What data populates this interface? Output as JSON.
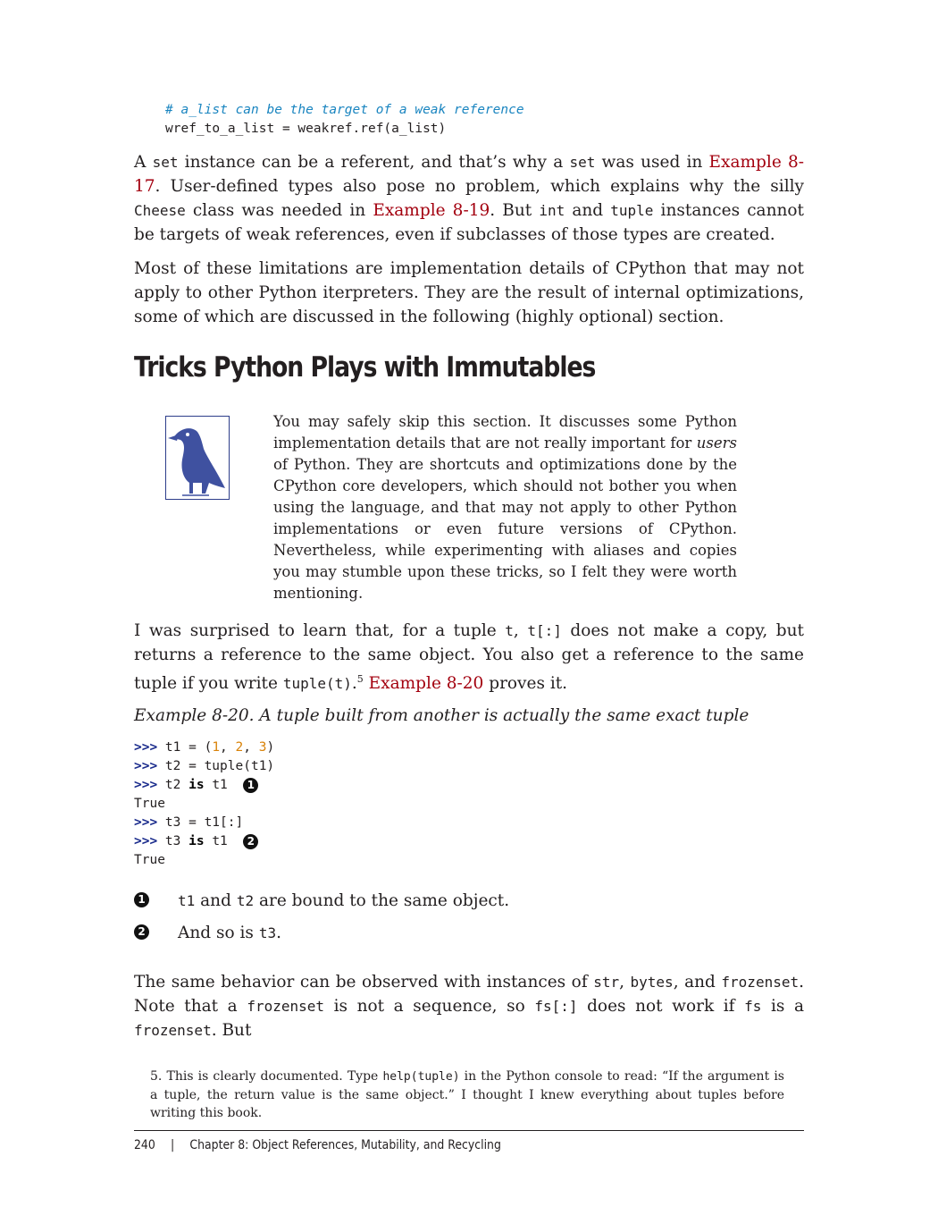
{
  "top_code": {
    "line1_comment": "# a_list can be the target of a weak reference",
    "line2": "wref_to_a_list = weakref.ref(a_list)"
  },
  "para1": {
    "t1": "A ",
    "c1": "set",
    "t2": " instance can be a referent, and that’s why a ",
    "c2": "set",
    "t3": " was used in ",
    "link1": "Example 8-17",
    "t4": ". User-defined types also pose no problem, which explains why the silly ",
    "c3": "Cheese",
    "t5": " class was needed in ",
    "link2": "Example 8-19",
    "t6": ". But ",
    "c4": "int",
    "t7": " and ",
    "c5": "tuple",
    "t8": " instances cannot be targets of weak references, even if subclasses of those types are created."
  },
  "para2": "Most of these limitations are implementation details of CPython that may not apply to other Python iterpreters. They are the result of internal optimizations, some of which are discussed in the following (highly optional) section.",
  "section_title": "Tricks Python Plays with Immutables",
  "note": {
    "icon": "crow-icon",
    "t1": "You may safely skip this section. It discusses some Python implementation details that are not really important for ",
    "em": "users",
    "t2": " of Python. They are shortcuts and optimizations done by the CPython core developers, which should not bother you when using the language, and that may not apply to other Python implementations or even future versions of CPython. Nevertheless, while experimenting with aliases and copies you may stumble upon these tricks, so I felt they were worth mentioning."
  },
  "para3": {
    "t1": "I was surprised to learn that, for a tuple ",
    "c1": "t",
    "t2": ", ",
    "c2": "t[:]",
    "t3": " does not make a copy, but returns a reference to the same object. You also get a reference to the same tuple if you write ",
    "c3": "tuple(t)",
    "t4": ".",
    "sup": "5",
    "t5": " ",
    "link": "Example 8-20",
    "t6": " proves it."
  },
  "example_caption": "Example 8-20. A tuple built from another is actually the same exact tuple",
  "example_code": {
    "prompt": ">>>",
    "l1_a": " t1 = (",
    "l1_n1": "1",
    "l1_b": ", ",
    "l1_n2": "2",
    "l1_c": ", ",
    "l1_n3": "3",
    "l1_d": ")",
    "l2": " t2 = tuple(t1)",
    "l3_a": " t2 ",
    "l3_kw": "is",
    "l3_b": " t1",
    "callout1": "1",
    "out1": "True",
    "l4": " t3 = t1[:]",
    "l5_a": " t3 ",
    "l5_kw": "is",
    "l5_b": " t1",
    "callout2": "2",
    "out2": "True"
  },
  "callouts": [
    {
      "marker": "1",
      "c1": "t1",
      "t1": " and ",
      "c2": "t2",
      "t2": " are bound to the same object."
    },
    {
      "marker": "2",
      "t1": "And so is ",
      "c1": "t3",
      "t2": "."
    }
  ],
  "para4": {
    "t1": "The same behavior can be observed with instances of ",
    "c1": "str",
    "t2": ", ",
    "c2": "bytes",
    "t3": ", and ",
    "c3": "frozenset",
    "t4": ". Note that a ",
    "c4": "frozenset",
    "t5": " is not a sequence, so ",
    "c5": "fs[:]",
    "t6": " does not work if ",
    "c6": "fs",
    "t7": " is a ",
    "c7": "frozenset",
    "t8": ". But"
  },
  "footnote": {
    "num": "5.",
    "t1": " This is clearly documented. Type ",
    "c1": "help(tuple)",
    "t2": " in the Python console to read: “If the argument is a tuple, the return value is the same object.” I thought I knew everything about tuples before writing this book."
  },
  "footer": {
    "page": "240",
    "sep": "|",
    "chapter": "Chapter 8: Object References, Mutability, and Recycling"
  }
}
